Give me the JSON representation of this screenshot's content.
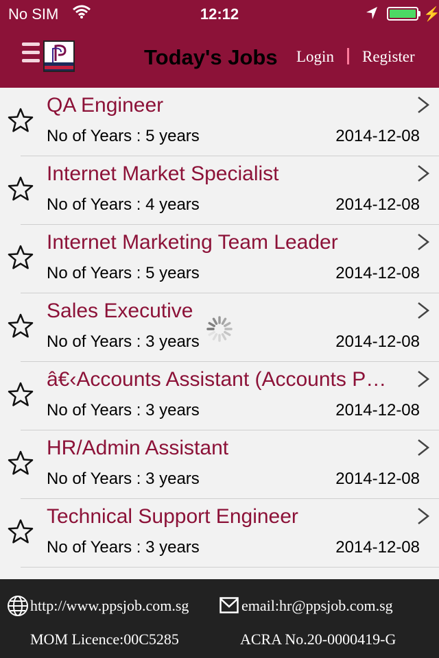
{
  "status_bar": {
    "carrier": "No SIM",
    "time": "12:12",
    "battery_color": "#4cd964"
  },
  "nav": {
    "title": "Today's Jobs",
    "login": "Login",
    "register": "Register",
    "brand_color": "#8c1238"
  },
  "jobs": [
    {
      "title": "QA Engineer",
      "years": "No of Years : 5 years",
      "date": "2014-12-08"
    },
    {
      "title": "Internet Market Specialist",
      "years": "No of Years : 4 years",
      "date": "2014-12-08"
    },
    {
      "title": "Internet Marketing Team Leader",
      "years": "No of Years : 5 years",
      "date": "2014-12-08"
    },
    {
      "title": "Sales Executive",
      "years": "No of Years : 3 years",
      "date": "2014-12-08"
    },
    {
      "title": "â€‹Accounts Assistant (Accounts Payable)",
      "years": "No of Years : 3 years",
      "date": "2014-12-08"
    },
    {
      "title": "HR/Admin Assistant",
      "years": "No of Years : 3 years",
      "date": "2014-12-08"
    },
    {
      "title": "Technical Support Engineer",
      "years": "No of Years : 3 years",
      "date": "2014-12-08"
    }
  ],
  "footer": {
    "website": "http://www.ppsjob.com.sg",
    "email": "email:hr@ppsjob.com.sg",
    "licence": "MOM Licence:00C5285",
    "acra": "ACRA No.20-0000419-G"
  },
  "icons": {
    "menu": "menu-icon",
    "logo": "pps-logo",
    "star": "star-outline-icon",
    "chevron": "chevron-right-icon",
    "globe": "globe-icon",
    "mail": "mail-icon",
    "spinner": "loading-spinner"
  }
}
